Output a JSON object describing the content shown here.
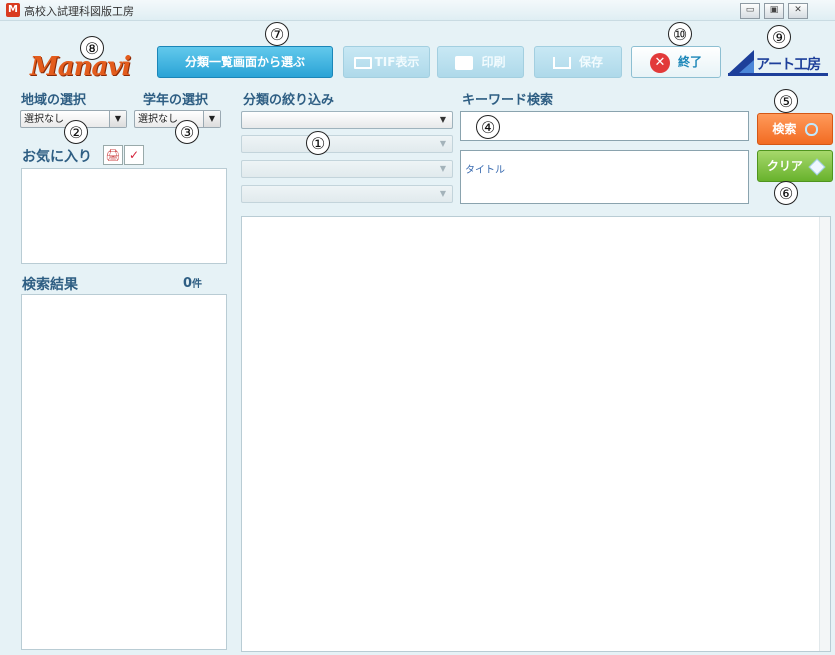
{
  "window": {
    "title": "高校入試理科図版工房",
    "app_icon": "M"
  },
  "window_controls": {
    "minimize": "▭",
    "restore": "▣",
    "close": "✕"
  },
  "logo": {
    "text": "Manavi"
  },
  "toolbar": {
    "select_from_list": "分類一覧画面から選ぶ",
    "tif_view": "TIF表示",
    "print": "印刷",
    "save": "保存",
    "exit": "終了",
    "exit_icon": "✕"
  },
  "brand": {
    "text": "アート工房"
  },
  "filters": {
    "region_label": "地域の選択",
    "region_value": "選択なし",
    "grade_label": "学年の選択",
    "grade_value": "選択なし",
    "category_label": "分類の絞り込み",
    "keyword_label": "キーワード検索",
    "keyword_value": "",
    "title_placeholder": "タイトル"
  },
  "favorites": {
    "label": "お気に入り",
    "print_icon": "🖨",
    "check_icon": "✓"
  },
  "results": {
    "label": "検索結果",
    "count": "0",
    "unit": "件"
  },
  "side_buttons": {
    "search": "検索",
    "clear": "クリア"
  },
  "callouts": [
    "①",
    "②",
    "③",
    "④",
    "⑤",
    "⑥",
    "⑦",
    "⑧",
    "⑨",
    "⑩"
  ],
  "arrows": {
    "down": "▼"
  },
  "colors": {
    "accent_blue": "#2aa3d6",
    "search_orange": "#f26b22",
    "clear_green": "#68b22c",
    "exit_red": "#e23a3a",
    "logo_orange": "#e35c1d"
  }
}
